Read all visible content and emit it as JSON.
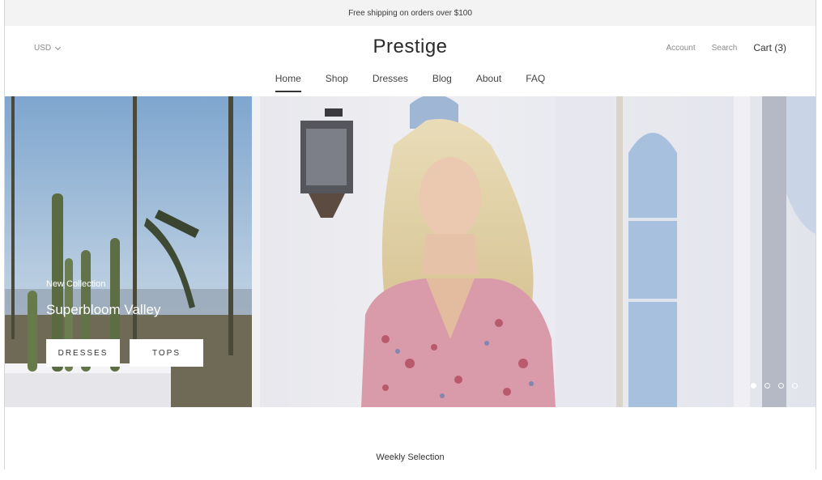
{
  "announcement": "Free shipping on orders over $100",
  "header": {
    "currency": "USD",
    "logo": "Prestige",
    "account": "Account",
    "search": "Search",
    "cart": "Cart (3)"
  },
  "nav": {
    "items": [
      "Home",
      "Shop",
      "Dresses",
      "Blog",
      "About",
      "FAQ"
    ],
    "active": "Home"
  },
  "hero": {
    "subtitle": "New Collection",
    "title": "Superbloom Valley",
    "buttons": [
      "DRESSES",
      "TOPS"
    ],
    "slide_count": 4,
    "active_slide": 1
  },
  "section": {
    "title": "Weekly Selection"
  },
  "colors": {
    "announcement_bg": "#f3f3f3",
    "text_dark": "#2a2a2a",
    "text_muted": "#8a8a8a"
  },
  "icons": [
    "chevron-down-icon"
  ]
}
